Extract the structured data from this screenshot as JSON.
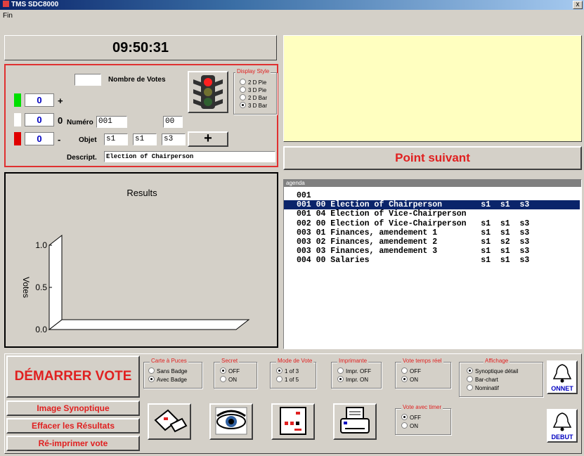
{
  "window": {
    "title": "TMS SDC8000",
    "close_label": "x"
  },
  "menu": {
    "items": [
      "Fin"
    ]
  },
  "clock": "09:50:31",
  "vote_panel": {
    "nombre_label": "Nombre de Votes",
    "nombre_value": "",
    "counters": [
      {
        "value": "0",
        "sign": "+",
        "color": "#00e000"
      },
      {
        "value": "0",
        "sign": "0",
        "color": "#ffffff"
      },
      {
        "value": "0",
        "sign": "-",
        "color": "#e00000"
      }
    ],
    "numero_label": "Numéro",
    "numero_value": "001",
    "numero_sub": "00",
    "objet_label": "Objet",
    "objet_values": [
      "s1",
      "s1",
      "s3"
    ],
    "descript_label": "Descript.",
    "descript_value": "Election of Chairperson",
    "add_label": "+",
    "display_style": {
      "title": "Display Style",
      "options": [
        "2 D Pie",
        "3 D Pie",
        "2 D Bar",
        "3 D Bar"
      ],
      "selected": "3 D Bar"
    }
  },
  "next_button": "Point suivant",
  "chart": {
    "title": "Results",
    "ylabel": "Votes",
    "yticks": [
      "1.0",
      "0.5",
      "0.0"
    ]
  },
  "chart_data": {
    "type": "bar",
    "title": "Results",
    "ylabel": "Votes",
    "ylim": [
      0,
      1.0
    ],
    "categories": [],
    "values": []
  },
  "agenda": {
    "header": "agenda",
    "rows": [
      {
        "text": "001",
        "selected": false
      },
      {
        "text": "001 00 Election of Chairperson        s1  s1  s3",
        "selected": true
      },
      {
        "text": "001 04 Election of Vice-Chairperson",
        "selected": false
      },
      {
        "text": "002 00 Election of Vice-Chairperson   s1  s1  s3",
        "selected": false
      },
      {
        "text": "003 01 Finances, amendement 1         s1  s1  s3",
        "selected": false
      },
      {
        "text": "003 02 Finances, amendement 2         s1  s2  s3",
        "selected": false
      },
      {
        "text": "003 03 Finances, amendement 3         s1  s1  s3",
        "selected": false
      },
      {
        "text": "004 00 Salaries                       s1  s1  s3",
        "selected": false
      }
    ]
  },
  "bottom": {
    "start_button": "DÉMARRER  VOTE",
    "image_synoptique": "Image Synoptique",
    "effacer": "Effacer les Résultats",
    "reimprimer": "Ré-imprimer vote",
    "groups": {
      "carte": {
        "title": "Carte à Puces",
        "options": [
          "Sans Badge",
          "Avec Badge"
        ],
        "selected": 1
      },
      "secret": {
        "title": "Secret",
        "options": [
          "OFF",
          "ON"
        ],
        "selected": 0
      },
      "mode": {
        "title": "Mode de Vote",
        "options": [
          "1 of 3",
          "1 of 5"
        ],
        "selected": 0
      },
      "imprimante": {
        "title": "Imprimante",
        "options": [
          "Impr. OFF",
          "Impr. ON"
        ],
        "selected": 1
      },
      "temps_reel": {
        "title": "Vote temps réel",
        "options": [
          "OFF",
          "ON"
        ],
        "selected": 1
      },
      "affichage": {
        "title": "Affichage",
        "options": [
          "Synoptique détail",
          "Bar-chart",
          "Nominatif"
        ],
        "selected": 0
      },
      "timer": {
        "title": "Vote avec timer",
        "options": [
          "OFF",
          "ON"
        ],
        "selected": 0
      }
    },
    "bell1_label": "ONNET",
    "bell2_label": "DEBUT"
  }
}
